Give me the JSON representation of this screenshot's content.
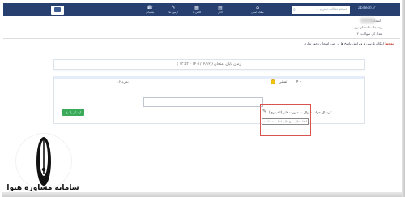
{
  "nav": {
    "logo_text": "abitech.ir",
    "search_placeholder": "جستجو مطالب درس و ...",
    "items": [
      {
        "label": "صفحه اصلی",
        "icon": "home-icon"
      },
      {
        "label": "اخبار",
        "icon": "news-icon"
      },
      {
        "label": "کلاس ها",
        "icon": "class-icon"
      },
      {
        "label": "آزمون ها",
        "icon": "exam-icon"
      },
      {
        "label": "پشتیبانی",
        "icon": "support-icon"
      }
    ]
  },
  "header": {
    "line1": "امتحان:",
    "line2": "توضیحات: امتحان ترم",
    "line3": "تعداد کل سوالات: ۱۲"
  },
  "notice": {
    "label": "توجه:",
    "text": "امکان بازبینی و ویرایش پاسخ ها در حین امتحان وجود ندارد."
  },
  "exam": {
    "end_time": "زمان پایان امتحان ( ۱۴۰۱/۰۲/۱۲ - ۱۳:۵۳ )"
  },
  "question": {
    "number": "۴ -",
    "type_label": "تستی",
    "score_label": "نمره ۰.۶",
    "optional_label": "ارسال جواب سوال به صورت فایل(اختیاری):",
    "file_hint": "انتخاب فایل - هیچ فایلی انتخاب نشده است",
    "send_label": "ارسال پاسخ"
  },
  "watermark": {
    "text": "سامانه مشاوره هیوا"
  },
  "colors": {
    "nav_bg": "#27406f",
    "notice_red": "#c0392b",
    "send_green": "#3bab5a",
    "highlight_red": "#d9534f"
  }
}
